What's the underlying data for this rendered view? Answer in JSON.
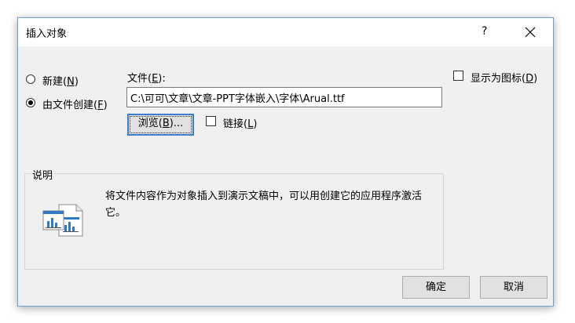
{
  "dialog": {
    "title": "插入对象",
    "help_label": "?",
    "options": {
      "create_new": {
        "label": "新建(",
        "key": "N",
        "suffix": ")",
        "selected": false
      },
      "create_from_file": {
        "label": "由文件创建(",
        "key": "F",
        "suffix": ")",
        "selected": true
      }
    },
    "file": {
      "label": "文件(",
      "key": "E",
      "suffix": "):",
      "value": "C:\\可可\\文章\\文章-PPT字体嵌入\\字体\\Arual.ttf"
    },
    "browse": {
      "label": "浏览(",
      "key": "B",
      "suffix": ")..."
    },
    "link": {
      "label": "链接(",
      "key": "L",
      "suffix": ")",
      "checked": false
    },
    "display_as_icon": {
      "label": "显示为图标(",
      "key": "D",
      "suffix": ")",
      "checked": false
    },
    "result": {
      "label": "说明",
      "text": "将文件内容作为对象插入到演示文稿中，可以用创建它的应用程序激活它。",
      "icon": "embedded-object-icon"
    },
    "buttons": {
      "ok": "确定",
      "cancel": "取消"
    }
  },
  "colors": {
    "accent": "#3c7fd0",
    "dialog_bg": "#f0f0f0",
    "border": "#6e9fd4"
  }
}
